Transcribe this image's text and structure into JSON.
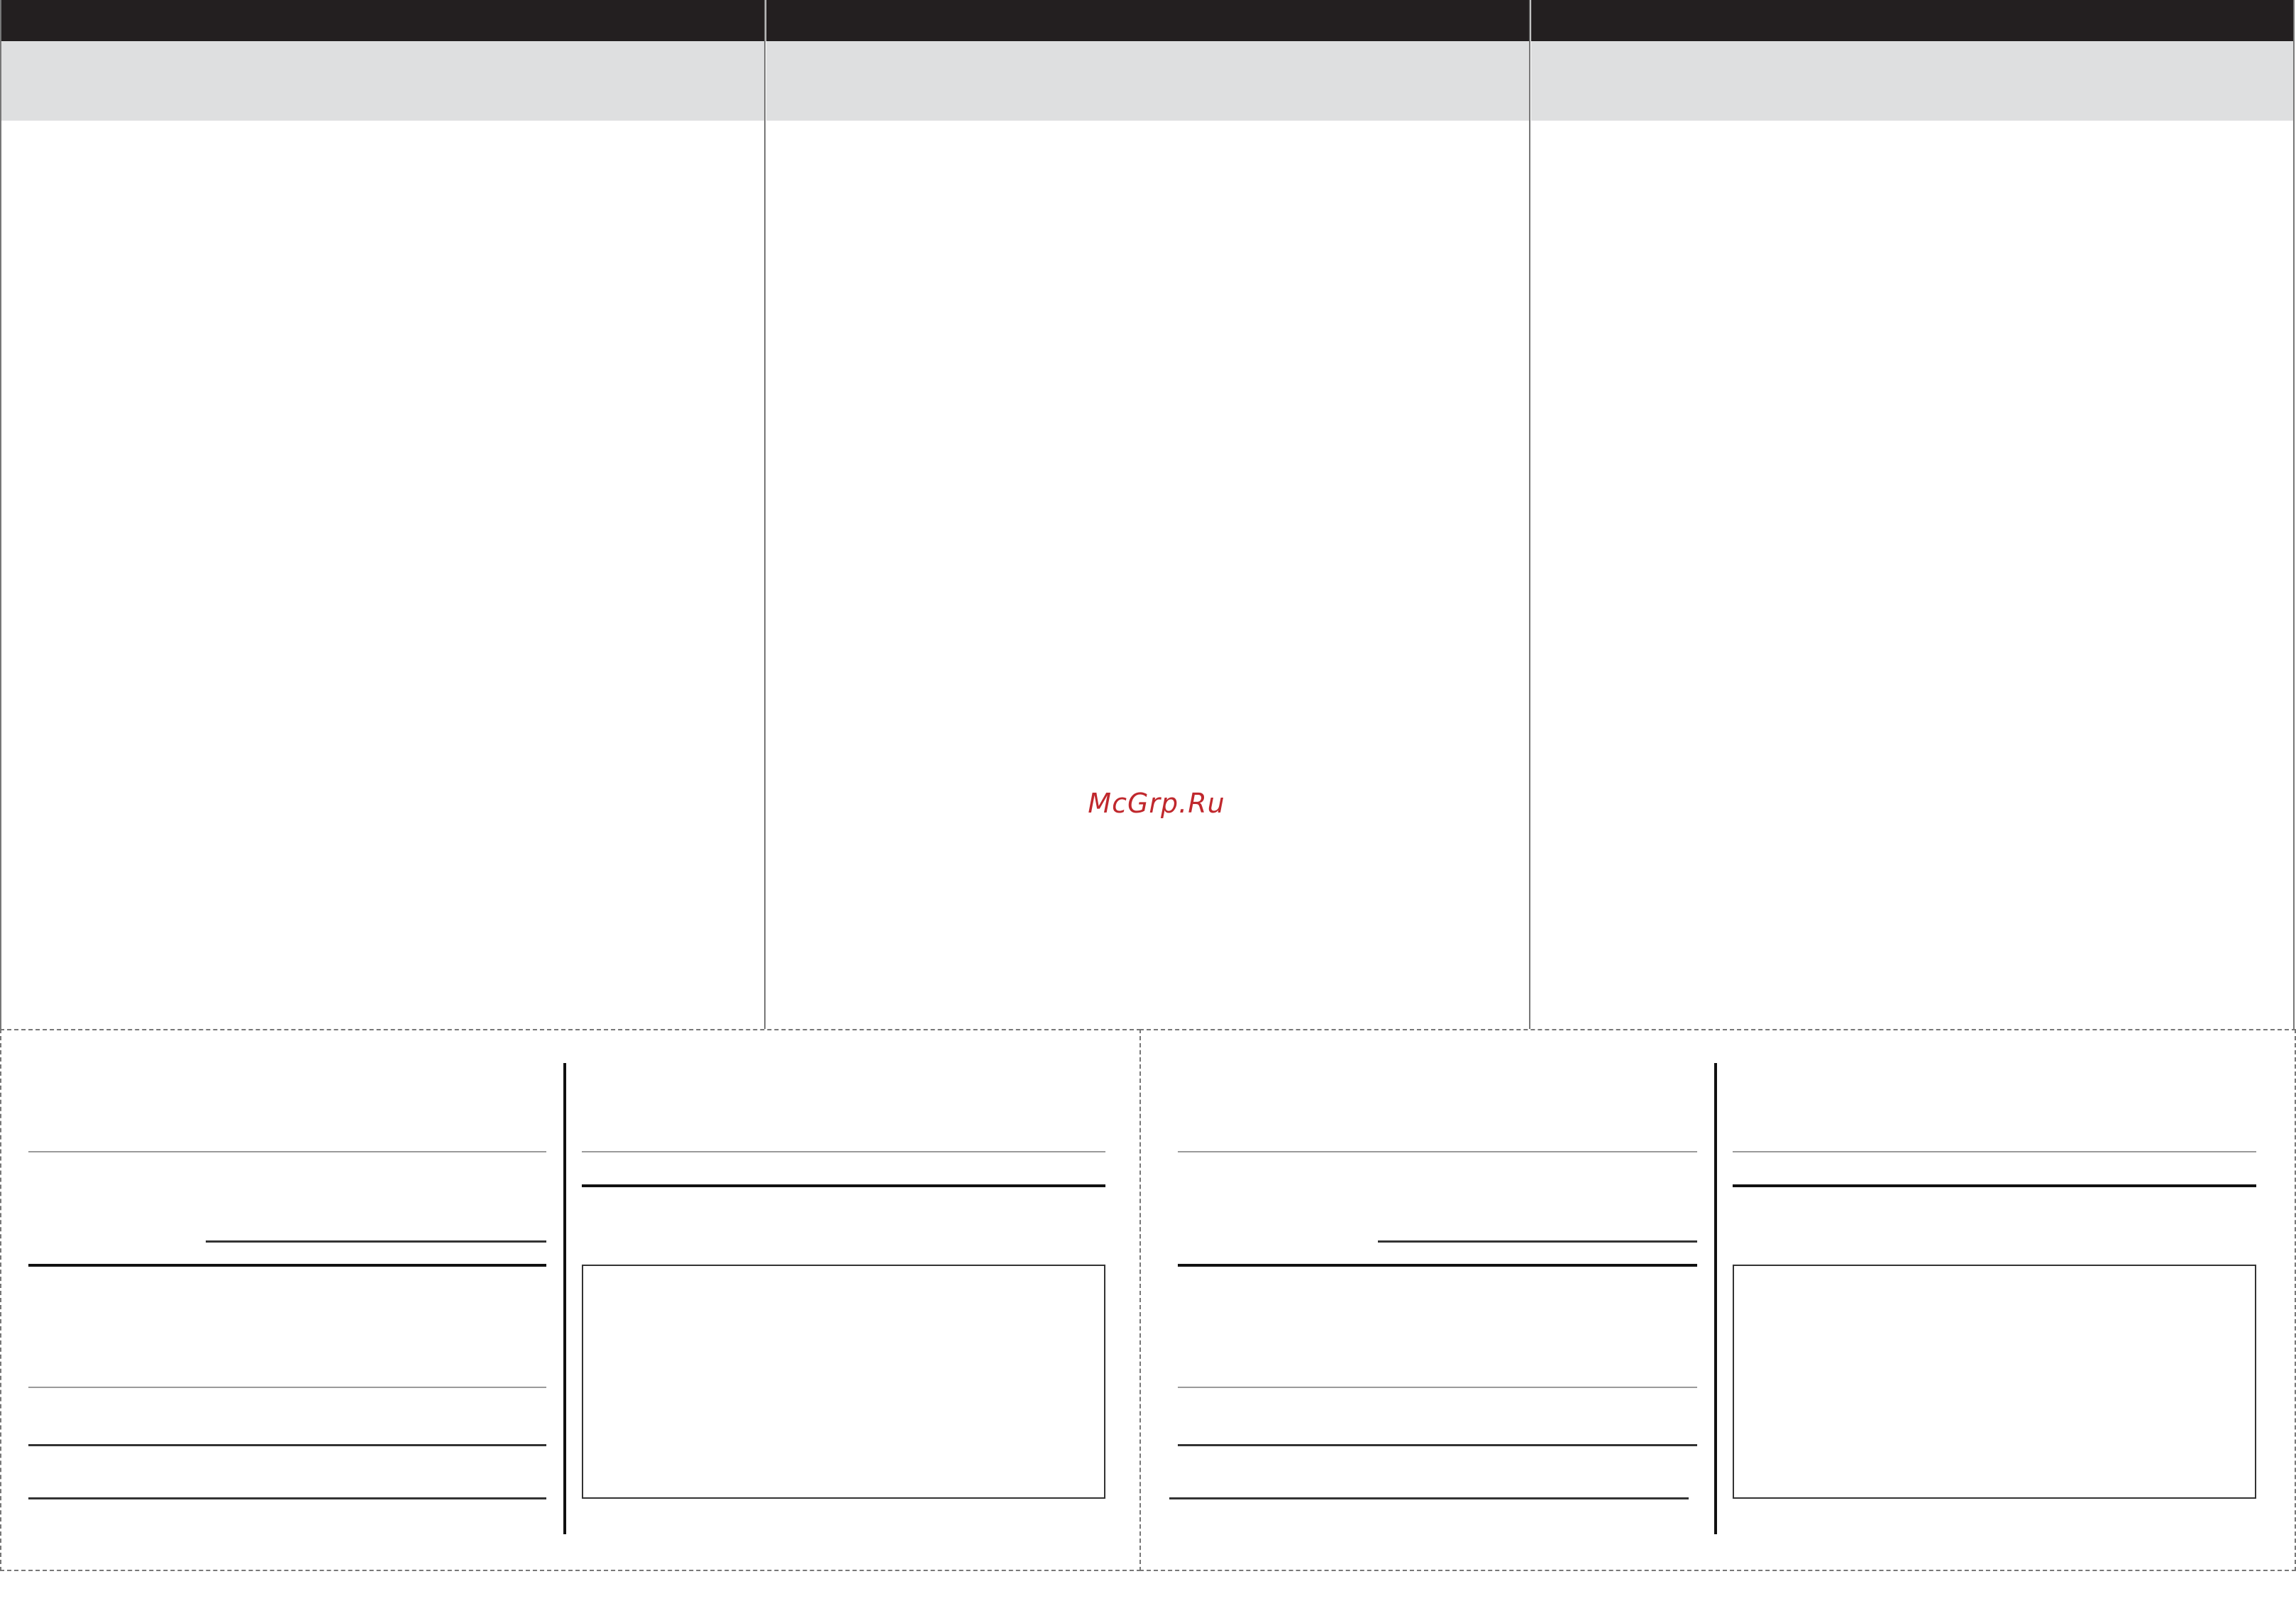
{
  "watermark": {
    "text": "McGrp.Ru",
    "color": "#c0282d"
  },
  "colors": {
    "header_bar": "#231f20",
    "subheader_band": "#dedfe0",
    "rule_dark": "#111111",
    "rule_light": "#9a9a9a"
  }
}
